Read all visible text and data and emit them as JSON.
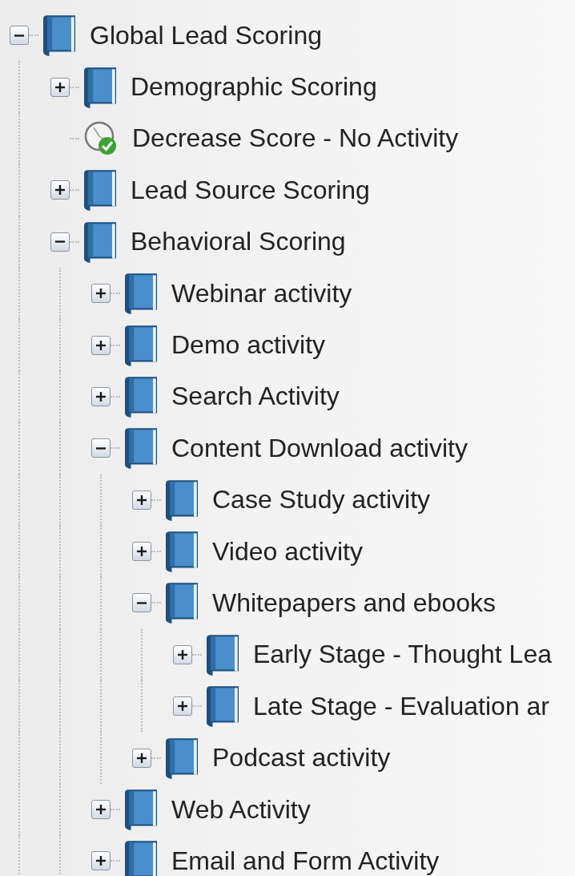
{
  "tree": [
    {
      "kind": "folder",
      "label": "Global Lead Scoring",
      "expanded": true,
      "children": [
        {
          "kind": "folder",
          "label": "Demographic Scoring",
          "expanded": false
        },
        {
          "kind": "campaign",
          "label": "Decrease Score - No Activity"
        },
        {
          "kind": "folder",
          "label": "Lead Source Scoring",
          "expanded": false
        },
        {
          "kind": "folder",
          "label": "Behavioral Scoring",
          "expanded": true,
          "children": [
            {
              "kind": "folder",
              "label": "Webinar activity",
              "expanded": false
            },
            {
              "kind": "folder",
              "label": "Demo activity",
              "expanded": false
            },
            {
              "kind": "folder",
              "label": "Search Activity",
              "expanded": false
            },
            {
              "kind": "folder",
              "label": "Content Download activity",
              "expanded": true,
              "children": [
                {
                  "kind": "folder",
                  "label": "Case Study activity",
                  "expanded": false
                },
                {
                  "kind": "folder",
                  "label": "Video activity",
                  "expanded": false
                },
                {
                  "kind": "folder",
                  "label": "Whitepapers and ebooks",
                  "expanded": true,
                  "children": [
                    {
                      "kind": "folder",
                      "label": "Early Stage - Thought Lea",
                      "expanded": false
                    },
                    {
                      "kind": "folder",
                      "label": "Late Stage - Evaluation ar",
                      "expanded": false
                    }
                  ]
                },
                {
                  "kind": "folder",
                  "label": "Podcast activity",
                  "expanded": false
                }
              ]
            },
            {
              "kind": "folder",
              "label": "Web Activity",
              "expanded": false
            },
            {
              "kind": "folder",
              "label": "Email and Form Activity",
              "expanded": false
            }
          ]
        }
      ]
    }
  ]
}
